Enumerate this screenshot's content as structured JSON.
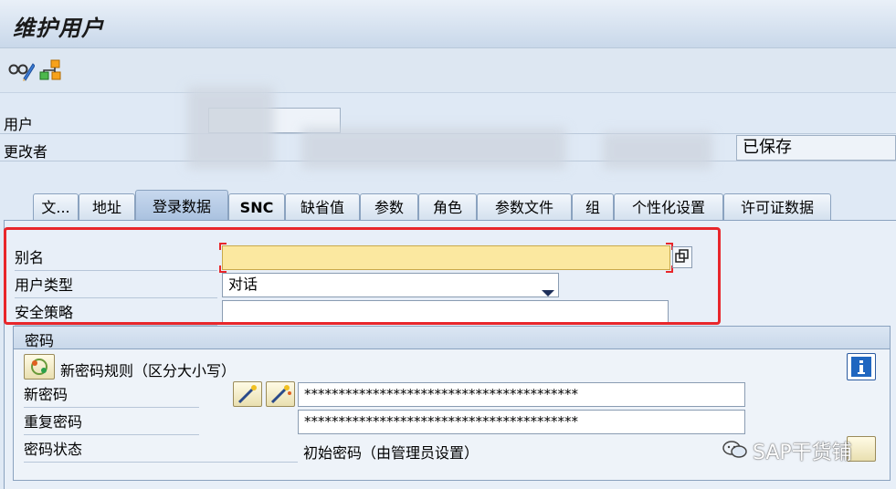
{
  "title": "维护用户",
  "header": {
    "user_label": "用户",
    "changed_by_label": "更改者",
    "status_value": "已保存"
  },
  "tabs": [
    "文...",
    "地址",
    "登录数据",
    "SNC",
    "缺省值",
    "参数",
    "角色",
    "参数文件",
    "组",
    "个性化设置",
    "许可证数据"
  ],
  "active_tab": "登录数据",
  "logon": {
    "alias_label": "别名",
    "alias_value": "",
    "user_type_label": "用户类型",
    "user_type_value": "对话",
    "security_policy_label": "安全策略",
    "security_policy_value": ""
  },
  "password": {
    "group_title": "密码",
    "rules_label": "新密码规则（区分大小写）",
    "new_password_label": "新密码",
    "new_password_value": "****************************************",
    "repeat_password_label": "重复密码",
    "repeat_password_value": "****************************************",
    "status_label": "密码状态",
    "status_value": "初始密码（由管理员设置）"
  },
  "watermark": "SAP干货铺",
  "icons": [
    "glasses-pencil-icon",
    "hierarchy-icon",
    "password-rules-icon",
    "generate-password-icon",
    "info-icon",
    "copy-icon",
    "dropdown-arrow-icon",
    "wechat-icon"
  ]
}
